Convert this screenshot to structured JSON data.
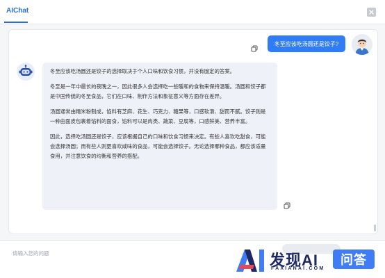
{
  "header": {
    "title": "AIChat"
  },
  "chat": {
    "user_message": "冬至应该吃汤圆还是饺子?",
    "bot_paragraphs": [
      "冬至应该吃汤圆还是饺子的选择取决于个人口味和饮食习惯，并没有固定的答案。",
      "冬至是一年中最长的夜晚之一，因此很多人会选择吃一些暖和的食物来保持温暖。汤圆和饺子都是中国传统的冬至食品，它们在口味、制作方法和象征意义等方面存在差异。",
      "汤圆通常由糯米粉制成，馅料有芝麻、花生、巧克力、糖果等，口感软滑、甜而不腻。饺子则是一种由面皮包裹着馅料的面食，馅料可以是肉类、蔬菜、豆腐等，口感鲜美、营养丰富。",
      "因此，选择吃汤圆还是饺子，应该根据自己的口味和饮食习惯来决定。有些人喜欢吃甜食，可能会选择汤圆；而有些人则更喜欢咸味的食品，可能会选择饺子。无论选择哪种食品，都应该适量食用，并注意饮食的均衡和营养的搭配。"
    ]
  },
  "input": {
    "placeholder": "请输入您的问题"
  },
  "watermark": {
    "title": "发现AI",
    "subtitle": "FAXIANAI.COM",
    "badge": "问答"
  },
  "colors": {
    "accent": "#2b6fd6",
    "user_bubble": "#2f7cf6",
    "bot_bubble": "#eef2f8"
  }
}
